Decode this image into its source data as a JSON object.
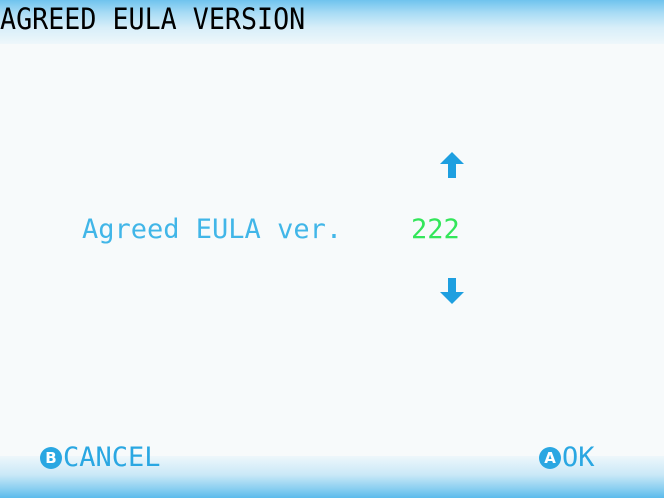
{
  "header": {
    "title": "AGREED EULA VERSION"
  },
  "main": {
    "label": "Agreed EULA ver.",
    "value": "222",
    "up_icon": "arrow-up-icon",
    "down_icon": "arrow-down-icon"
  },
  "footer": {
    "cancel": {
      "icon_letter": "B",
      "label": "CANCEL"
    },
    "ok": {
      "icon_letter": "A",
      "label": "OK"
    }
  },
  "colors": {
    "accent": "#41b6e8",
    "value": "#33e65a",
    "button": "#2aa7e2",
    "background": "#f7fafb"
  }
}
